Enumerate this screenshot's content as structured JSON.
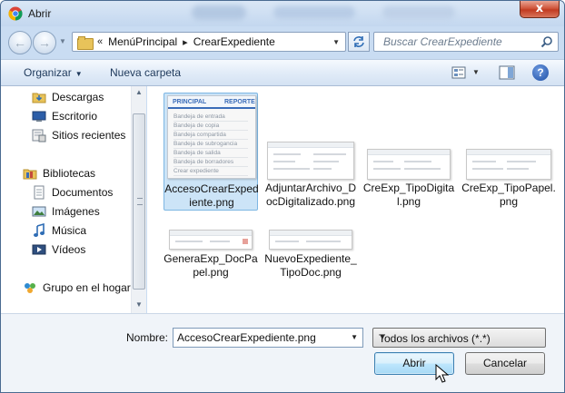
{
  "window": {
    "title": "Abrir",
    "close_label": "x"
  },
  "navigation": {
    "back_label": "←",
    "forward_label": "→"
  },
  "address": {
    "overflow": "«",
    "crumbs": [
      "MenúPrincipal",
      "CrearExpediente"
    ],
    "separator": "▸"
  },
  "search": {
    "placeholder": "Buscar CrearExpediente"
  },
  "toolbar": {
    "organize_label": "Organizar",
    "new_folder_label": "Nueva carpeta",
    "help_label": "?"
  },
  "sidebar": {
    "items": [
      {
        "label": "Descargas",
        "icon": "downloads-folder-icon"
      },
      {
        "label": "Escritorio",
        "icon": "desktop-icon"
      },
      {
        "label": "Sitios recientes",
        "icon": "recent-places-icon"
      },
      {
        "label": "Bibliotecas",
        "icon": "libraries-icon"
      },
      {
        "label": "Documentos",
        "icon": "documents-icon"
      },
      {
        "label": "Imágenes",
        "icon": "pictures-icon"
      },
      {
        "label": "Música",
        "icon": "music-icon"
      },
      {
        "label": "Vídeos",
        "icon": "videos-icon"
      },
      {
        "label": "Grupo en el hogar",
        "icon": "homegroup-icon"
      }
    ]
  },
  "files": [
    {
      "name": "AccesoCrearExpediente.png",
      "selected": true
    },
    {
      "name": "AdjuntarArchivo_DocDigitalizado.png",
      "selected": false
    },
    {
      "name": "CreExp_TipoDigital.png",
      "selected": false
    },
    {
      "name": "CreExp_TipoPapel.png",
      "selected": false
    },
    {
      "name": "GeneraExp_DocPapel.png",
      "selected": false
    },
    {
      "name": "NuevoExpediente_TipoDoc.png",
      "selected": false
    }
  ],
  "thumbnail_acceso": {
    "tab_left": "PRINCIPAL",
    "tab_right": "REPORTE",
    "menu": [
      "Bandeja de entrada",
      "Bandeja de copia",
      "Bandeja compartida",
      "Bandeja de subrogancia",
      "Bandeja de salida",
      "Bandeja de borradores",
      "Crear expediente"
    ]
  },
  "bottom": {
    "filename_label": "Nombre:",
    "filename_value": "AccesoCrearExpediente.png",
    "filetype_value": "Todos los archivos (*.*)",
    "open_label": "Abrir",
    "cancel_label": "Cancelar"
  },
  "colors": {
    "accent": "#3a6cb8",
    "selection": "#cce4f7",
    "close": "#c13b21"
  }
}
